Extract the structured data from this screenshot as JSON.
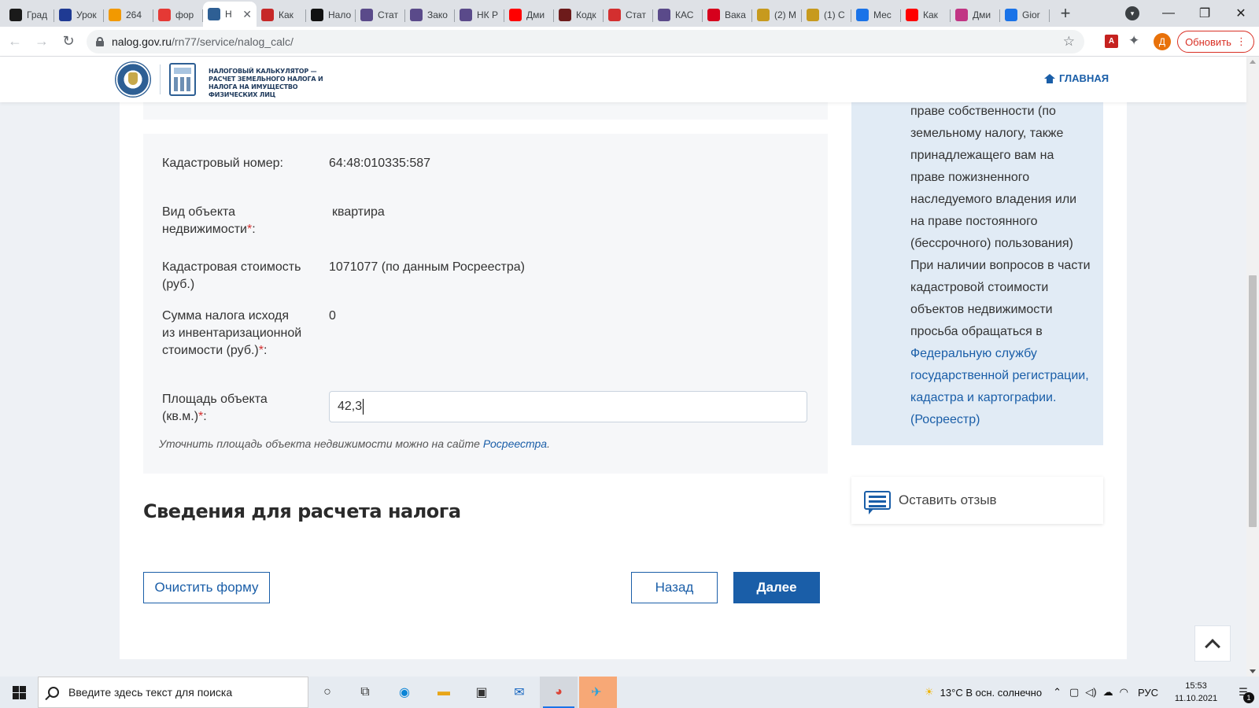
{
  "browser": {
    "tabs": [
      {
        "title": "Град",
        "favicon": "inv",
        "color": "#1a1a1a"
      },
      {
        "title": "Урок",
        "favicon": "uk-flag",
        "color": "#1f3a93"
      },
      {
        "title": "264",
        "favicon": "mail",
        "color": "#f29900"
      },
      {
        "title": "фор",
        "favicon": "yandex",
        "color": "#e53935"
      },
      {
        "title": "Н",
        "favicon": "fns",
        "color": "#2e5f94",
        "active": true
      },
      {
        "title": "Как",
        "favicon": "hh",
        "color": "#c62828"
      },
      {
        "title": "Нало",
        "favicon": "tm",
        "color": "#111111"
      },
      {
        "title": "Стат",
        "favicon": "fns",
        "color": "#5a4a8a"
      },
      {
        "title": "Зако",
        "favicon": "fns",
        "color": "#5a4a8a"
      },
      {
        "title": "НК Р",
        "favicon": "fns",
        "color": "#5a4a8a"
      },
      {
        "title": "Дми",
        "favicon": "youtube",
        "color": "#ff0000"
      },
      {
        "title": "Кодк",
        "favicon": "N",
        "color": "#6d1b1b"
      },
      {
        "title": "Стат",
        "favicon": "flag",
        "color": "#d32f2f"
      },
      {
        "title": "КАС",
        "favicon": "fns",
        "color": "#5a4a8a"
      },
      {
        "title": "Вака",
        "favicon": "hh",
        "color": "#d6001c"
      },
      {
        "title": "(2) М",
        "favicon": "shield",
        "color": "#c79a1e"
      },
      {
        "title": "(1) С",
        "favicon": "shield",
        "color": "#c79a1e"
      },
      {
        "title": "Мес",
        "favicon": "pause",
        "color": "#1a73e8"
      },
      {
        "title": "Как",
        "favicon": "youtube",
        "color": "#ff0000"
      },
      {
        "title": "Дми",
        "favicon": "instagram",
        "color": "#c13584"
      },
      {
        "title": "Gior",
        "favicon": "pause",
        "color": "#1a73e8"
      }
    ],
    "url_host": "nalog.gov.ru",
    "url_path": "/rn77/service/nalog_calc/",
    "update_label": "Обновить",
    "profile_initial": "Д",
    "pdf_label": "A"
  },
  "site": {
    "header_title": "Налоговый калькулятор — расчет земельного налога и налога на имущество физических лиц",
    "home_label": "ГЛАВНАЯ"
  },
  "form": {
    "cadastral_number_label": "Кадастровый номер:",
    "cadastral_number_value": "64:48:010335:587",
    "object_type_label": "Вид объекта недвижимости",
    "object_type_value": "квартира",
    "cadastral_cost_label": "Кадастровая стоимость (руб.)",
    "cadastral_cost_value": "1071077 (по данным Росреестра)",
    "inventory_tax_label": "Сумма налога исходя из инвентаризационной стоимости (руб.)",
    "inventory_tax_value": "0",
    "area_label": "Площадь объекта (кв.м.)",
    "area_value": "42,3",
    "required_mark": "*",
    "colon": ":",
    "hint_text": "Уточнить площадь объекта недвижимости можно на сайте ",
    "hint_link": "Росреестра",
    "hint_end": "."
  },
  "section": {
    "title": "Сведения для расчета налога"
  },
  "buttons": {
    "clear": "Очистить форму",
    "back": "Назад",
    "next": "Далее"
  },
  "sidebar": {
    "info_text": "праве собственности (по земельному налогу, также принадлежащего вам на праве пожизненного наследуемого владения или на праве постоянного (бессрочного) пользования) При наличии вопросов в части кадастровой стоимости объектов недвижимости просьба обращаться в ",
    "info_link": "Федеральную службу государственной регистрации, кадастра и картографии. (Росреестр)",
    "feedback_label": "Оставить отзыв"
  },
  "taskbar": {
    "search_placeholder": "Введите здесь текст для поиска",
    "weather": "13°C  В осн. солнечно",
    "lang": "РУС",
    "time": "15:53",
    "date": "11.10.2021",
    "notification_count": "1"
  },
  "colors": {
    "accent": "#1a5ea8",
    "required": "#d32f2f",
    "sidebar_bg": "#e1ebf5"
  }
}
